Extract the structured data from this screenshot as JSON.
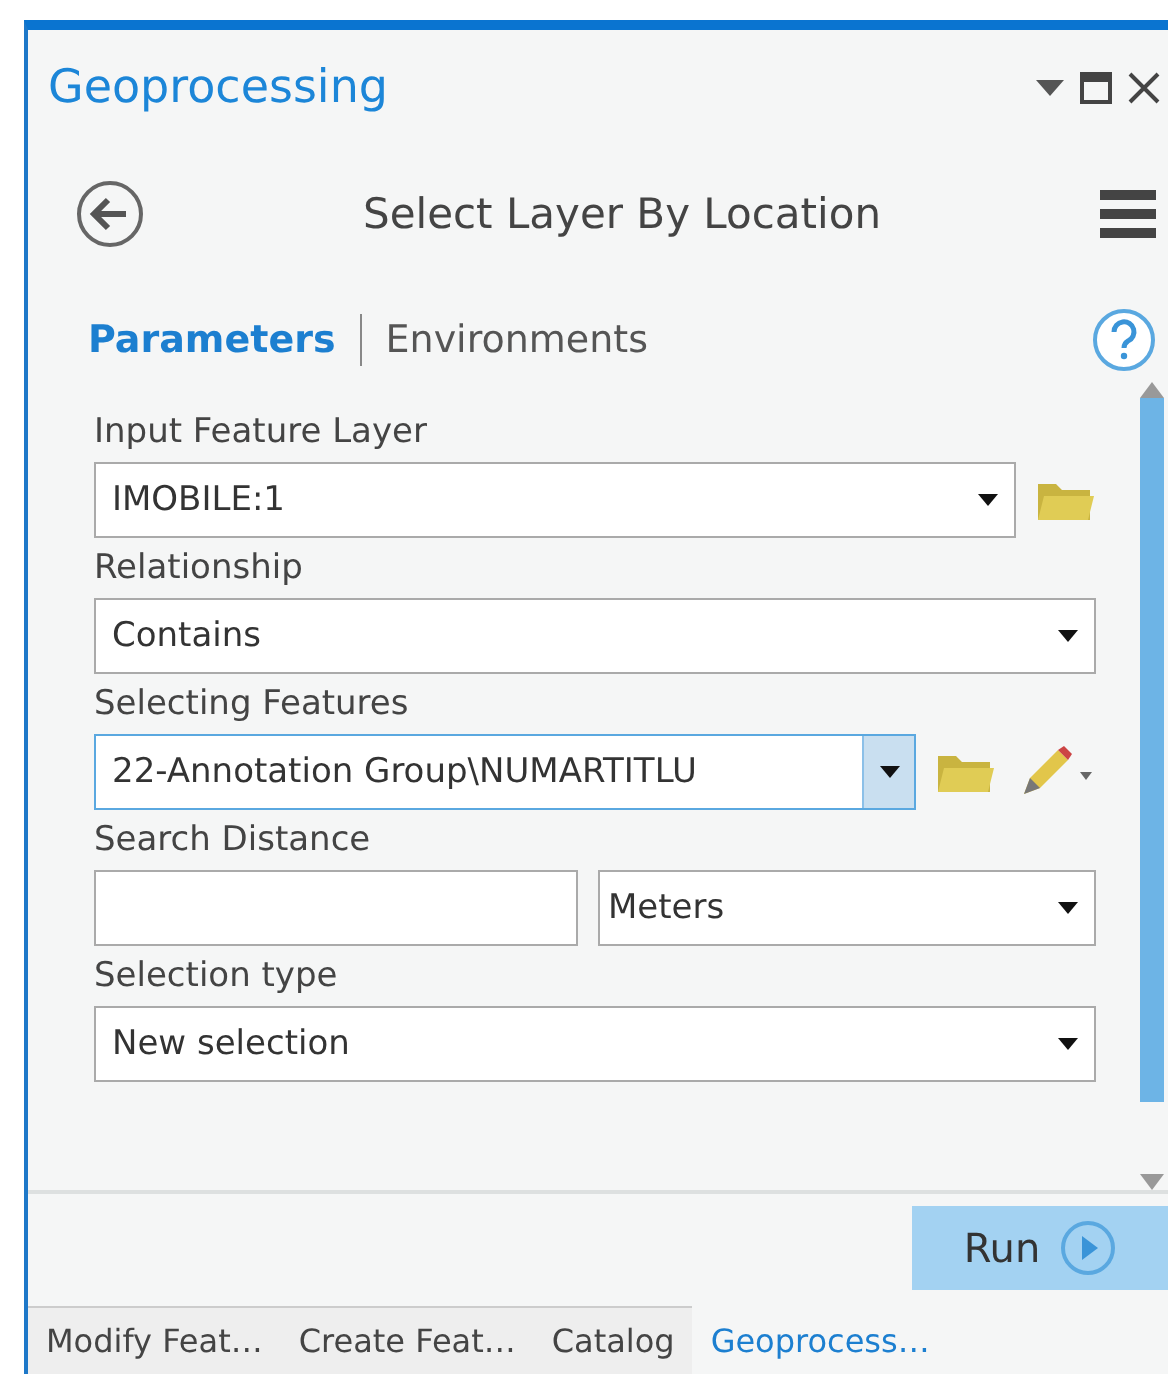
{
  "panel": {
    "title": "Geoprocessing"
  },
  "tool": {
    "title": "Select Layer By Location"
  },
  "tabs": [
    {
      "label": "Parameters",
      "selected": true
    },
    {
      "label": "Environments",
      "selected": false
    }
  ],
  "parameters": [
    {
      "kind": "dropdown",
      "label": "Input Feature Layer",
      "value": "IMOBILE:1",
      "browse": true,
      "sketch": false,
      "focused": false
    },
    {
      "kind": "dropdown",
      "label": "Relationship",
      "value": "Contains",
      "browse": false,
      "sketch": false,
      "focused": false
    },
    {
      "kind": "dropdown",
      "label": "Selecting Features",
      "value": "22-Annotation Group\\NUMARTITLU",
      "browse": true,
      "sketch": true,
      "focused": true
    },
    {
      "kind": "distance",
      "label": "Search Distance",
      "unit": "Meters",
      "browse": false,
      "sketch": false,
      "focused": false
    },
    {
      "kind": "dropdown",
      "label": "Selection type",
      "value": "New selection",
      "browse": false,
      "sketch": false,
      "focused": false
    }
  ],
  "run_button": {
    "label": "Run"
  },
  "dock_tabs": [
    {
      "label": "Modify Feat…",
      "selected": false
    },
    {
      "label": "Create Feat…",
      "selected": false
    },
    {
      "label": "Catalog",
      "selected": false
    },
    {
      "label": "Geoprocess…",
      "selected": true
    }
  ]
}
